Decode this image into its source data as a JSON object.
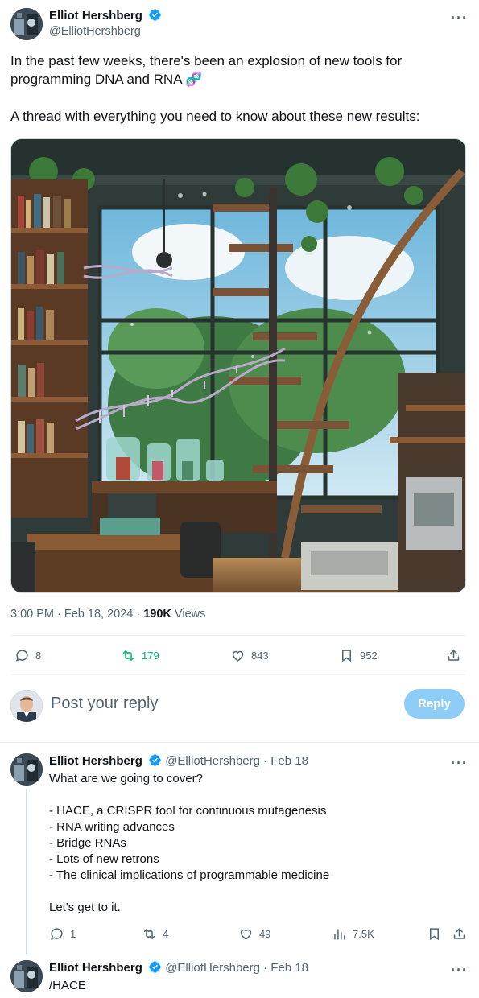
{
  "main_tweet": {
    "author_name": "Elliot Hershberg",
    "handle": "@ElliotHershberg",
    "text_line1": "In the past few weeks, there's been an explosion of new tools for",
    "text_line2": "programming DNA and RNA",
    "emoji": "🧬",
    "text_line3": "A thread with everything you need to know about these new results:",
    "time": "3:00 PM · Feb 18, 2024 · ",
    "views_count": "190K",
    "views_label": " Views",
    "replies": "8",
    "retweets": "179",
    "likes": "843",
    "bookmarks": "952"
  },
  "reply_box": {
    "placeholder": "Post your reply",
    "button_label": "Reply"
  },
  "thread": [
    {
      "author_name": "Elliot Hershberg",
      "handle_date": "@ElliotHershberg · Feb 18",
      "lines": [
        "What are we going to cover?",
        "- HACE, a CRISPR tool for continuous mutagenesis",
        "- RNA writing advances",
        "- Bridge RNAs",
        "- Lots of new retrons",
        "- The clinical implications of programmable medicine",
        "Let's get to it."
      ],
      "replies": "1",
      "retweets": "4",
      "likes": "49",
      "views": "7.5K"
    },
    {
      "author_name": "Elliot Hershberg",
      "handle_date": "@ElliotHershberg · Feb 18",
      "text": "/HACE"
    }
  ],
  "colors": {
    "accent": "#1d9bf0",
    "retweet_green": "#00ba7c",
    "muted": "#536471",
    "reply_button_disabled": "#8ecdf8"
  }
}
